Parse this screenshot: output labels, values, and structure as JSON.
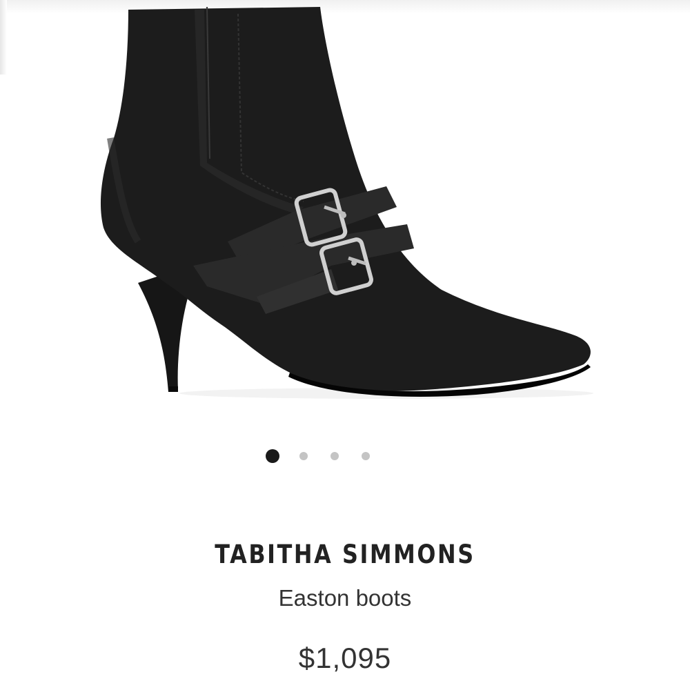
{
  "product": {
    "brand": "TABITHA SIMMONS",
    "name": "Easton boots",
    "price": "$1,095",
    "image_icon": "black-suede-ankle-boot-image"
  },
  "carousel": {
    "total": 4,
    "active_index": 0
  },
  "colors": {
    "boot": "#1c1c1c",
    "buckle": "#c9c9c9",
    "dot_active": "#1a1a1a",
    "dot_inactive": "#c4c4c4"
  }
}
